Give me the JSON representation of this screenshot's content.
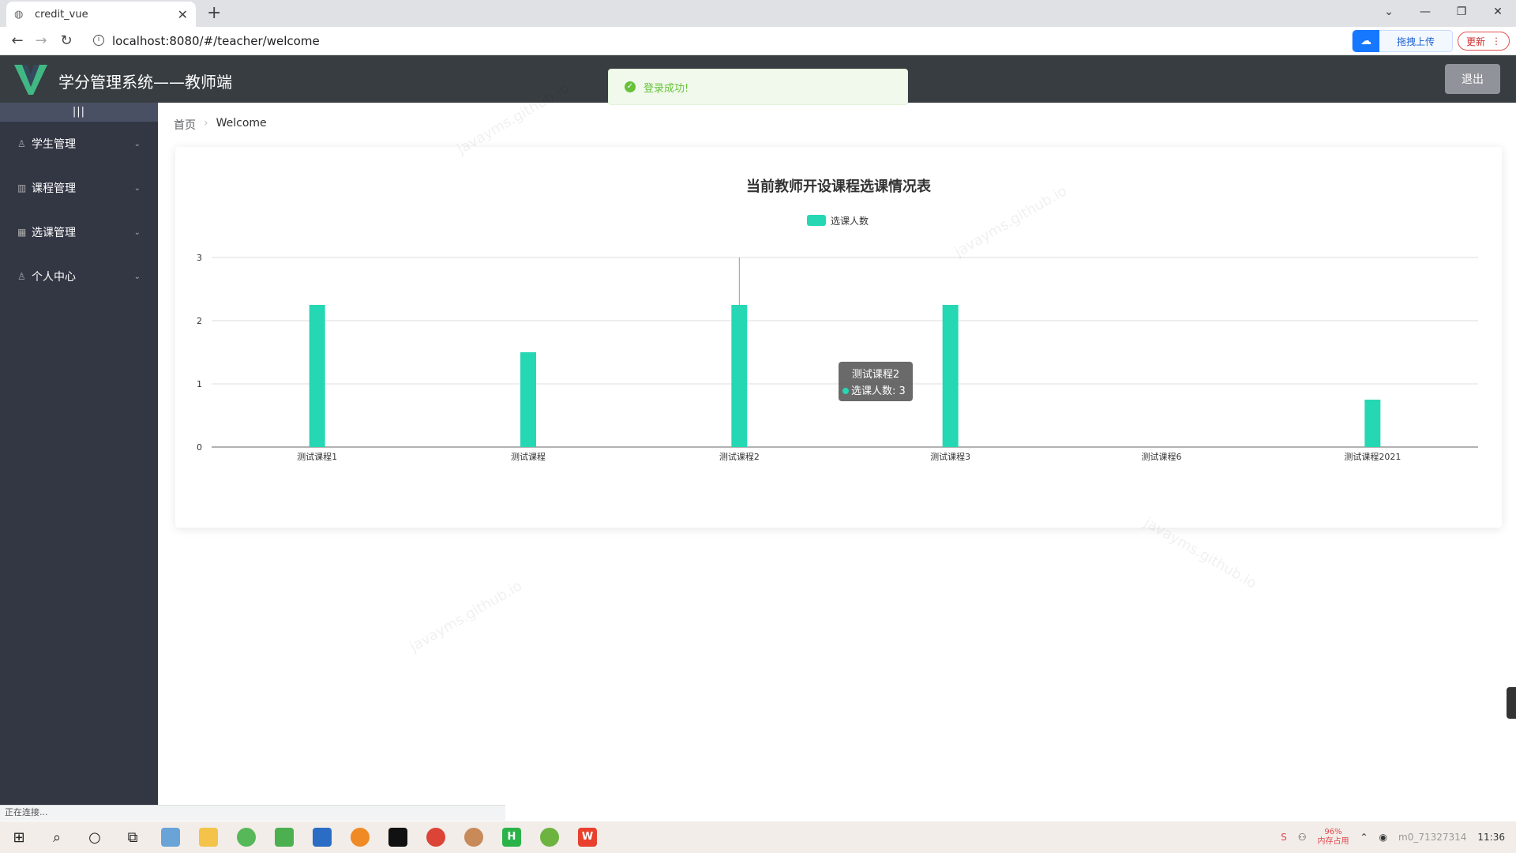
{
  "browser": {
    "tab_title": "credit_vue",
    "url": "localhost:8080/#/teacher/welcome",
    "ext_label": "拖拽上传",
    "update_label": "更新",
    "status_text": "正在连接..."
  },
  "header": {
    "title": "学分管理系统——教师端",
    "logout_label": "退出"
  },
  "toast": {
    "message": "登录成功!"
  },
  "sidebar": {
    "toggle_label": "|||",
    "items": [
      {
        "label": "学生管理"
      },
      {
        "label": "课程管理"
      },
      {
        "label": "选课管理"
      },
      {
        "label": "个人中心"
      }
    ]
  },
  "breadcrumb": {
    "home": "首页",
    "current": "Welcome"
  },
  "chart_data": {
    "type": "bar",
    "title": "当前教师开设课程选课情况表",
    "categories": [
      "测试课程1",
      "测试课程",
      "测试课程2",
      "测试课程3",
      "测试课程6",
      "测试课程2021"
    ],
    "series": [
      {
        "name": "选课人数",
        "values": [
          2.25,
          1.5,
          2.25,
          2.25,
          0,
          0.75
        ]
      }
    ],
    "ylim": [
      0,
      3
    ],
    "yticks": [
      0,
      1,
      2,
      3
    ],
    "legend_position": "top-center",
    "bar_color": "#26d7b3",
    "tooltip": {
      "category": "测试课程2",
      "line": "选课人数: 3"
    }
  },
  "watermark": "javayms.github.io",
  "taskbar": {
    "mem_percent": "96%",
    "mem_label": "内存占用",
    "time": "11:36",
    "tray_text": "m0_71327314"
  }
}
